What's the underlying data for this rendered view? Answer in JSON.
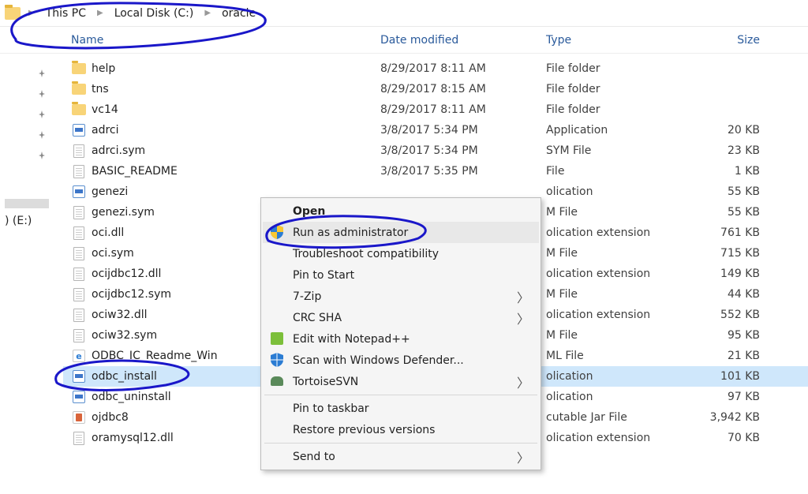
{
  "breadcrumb": {
    "segments": [
      "This PC",
      "Local Disk (C:)",
      "oracle"
    ]
  },
  "columns": {
    "name": "Name",
    "date": "Date modified",
    "type": "Type",
    "size": "Size"
  },
  "sidebar": {
    "drive_label": ") (E:)"
  },
  "files": [
    {
      "icon": "folder",
      "name": "help",
      "date": "8/29/2017 8:11 AM",
      "type": "File folder",
      "size": ""
    },
    {
      "icon": "folder",
      "name": "tns",
      "date": "8/29/2017 8:15 AM",
      "type": "File folder",
      "size": ""
    },
    {
      "icon": "folder",
      "name": "vc14",
      "date": "8/29/2017 8:11 AM",
      "type": "File folder",
      "size": ""
    },
    {
      "icon": "exe",
      "name": "adrci",
      "date": "3/8/2017 5:34 PM",
      "type": "Application",
      "size": "20 KB"
    },
    {
      "icon": "file",
      "name": "adrci.sym",
      "date": "3/8/2017 5:34 PM",
      "type": "SYM File",
      "size": "23 KB"
    },
    {
      "icon": "file",
      "name": "BASIC_README",
      "date": "3/8/2017 5:35 PM",
      "type": "File",
      "size": "1 KB"
    },
    {
      "icon": "exe",
      "name": "genezi",
      "date": "",
      "type": "olication",
      "size": "55 KB"
    },
    {
      "icon": "file",
      "name": "genezi.sym",
      "date": "",
      "type": "M File",
      "size": "55 KB"
    },
    {
      "icon": "file",
      "name": "oci.dll",
      "date": "",
      "type": "olication extension",
      "size": "761 KB"
    },
    {
      "icon": "file",
      "name": "oci.sym",
      "date": "",
      "type": "M File",
      "size": "715 KB"
    },
    {
      "icon": "file",
      "name": "ocijdbc12.dll",
      "date": "",
      "type": "olication extension",
      "size": "149 KB"
    },
    {
      "icon": "file",
      "name": "ocijdbc12.sym",
      "date": "",
      "type": "M File",
      "size": "44 KB"
    },
    {
      "icon": "file",
      "name": "ociw32.dll",
      "date": "",
      "type": "olication extension",
      "size": "552 KB"
    },
    {
      "icon": "file",
      "name": "ociw32.sym",
      "date": "",
      "type": "M File",
      "size": "95 KB"
    },
    {
      "icon": "ie",
      "name": "ODBC_IC_Readme_Win",
      "date": "",
      "type": "ML File",
      "size": "21 KB"
    },
    {
      "icon": "exe",
      "name": "odbc_install",
      "date": "",
      "type": "olication",
      "size": "101 KB",
      "sel": true
    },
    {
      "icon": "exe",
      "name": "odbc_uninstall",
      "date": "",
      "type": "olication",
      "size": "97 KB"
    },
    {
      "icon": "jar",
      "name": "ojdbc8",
      "date": "",
      "type": "cutable Jar File",
      "size": "3,942 KB"
    },
    {
      "icon": "file",
      "name": "oramysql12.dll",
      "date": "",
      "type": "olication extension",
      "size": "70 KB"
    }
  ],
  "context_menu": {
    "open": "Open",
    "run_admin": "Run as administrator",
    "troubleshoot": "Troubleshoot compatibility",
    "pin_start": "Pin to Start",
    "sevenzip": "7-Zip",
    "crc": "CRC SHA",
    "notepadpp": "Edit with Notepad++",
    "defender": "Scan with Windows Defender...",
    "tortoise": "TortoiseSVN",
    "pin_taskbar": "Pin to taskbar",
    "restore": "Restore previous versions",
    "sendto": "Send to"
  }
}
